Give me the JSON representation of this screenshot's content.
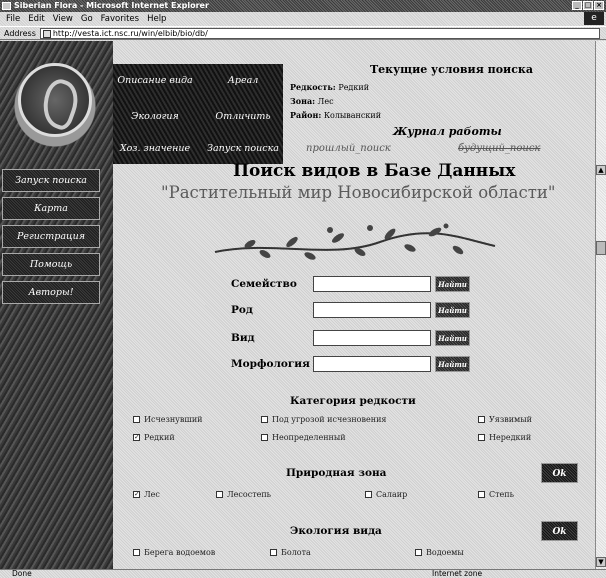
{
  "window": {
    "title": "Siberian Flora - Microsoft Internet Explorer"
  },
  "menu": {
    "items": [
      "File",
      "Edit",
      "View",
      "Go",
      "Favorites",
      "Help"
    ]
  },
  "address": {
    "label": "Address",
    "url": "http://vesta.ict.nsc.ru/win/elbib/bio/db/"
  },
  "sidebar": {
    "items": [
      "Запуск поиска",
      "Карта",
      "Регистрация",
      "Помощь",
      "Авторы!"
    ]
  },
  "topnav": {
    "items": [
      "Описание вида",
      "Ареал",
      "Экология",
      "Отличить",
      "Хоз. значение",
      "Запуск поиска"
    ]
  },
  "conditions": {
    "heading": "Текущие условия поиска",
    "rarity_label": "Редкость:",
    "rarity_value": "Редкий",
    "zone_label": "Зона:",
    "zone_value": "Лес",
    "region_label": "Район:",
    "region_value": "Колыванский"
  },
  "journal": {
    "heading": "Журнал работы",
    "prev": "прошлый_поиск",
    "next": "будущий_поиск"
  },
  "main": {
    "title": "Поиск видов в Базе Данных",
    "subtitle": "\"Растительный мир Новосибирской области\""
  },
  "search_form": {
    "fields": [
      "Семейство",
      "Род",
      "Вид",
      "Морфология"
    ],
    "button_label": "Найти"
  },
  "rarity": {
    "title": "Категория редкости",
    "options": [
      "Исчезнувший",
      "Под угрозой исчезновения",
      "Уязвимый",
      "Редкий",
      "Неопределенный",
      "Нередкий"
    ],
    "checked": "Редкий"
  },
  "nat_zone": {
    "title": "Природная зона",
    "options": [
      "Лес",
      "Лесостепь",
      "Салаир",
      "Степь"
    ],
    "checked": "Лес",
    "button": "Ok"
  },
  "ecology": {
    "title": "Экология вида",
    "options": [
      "Берега водоемов",
      "Болота",
      "Водоемы"
    ],
    "button": "Ok"
  },
  "status": {
    "text": "Done",
    "zone": "Internet zone"
  }
}
